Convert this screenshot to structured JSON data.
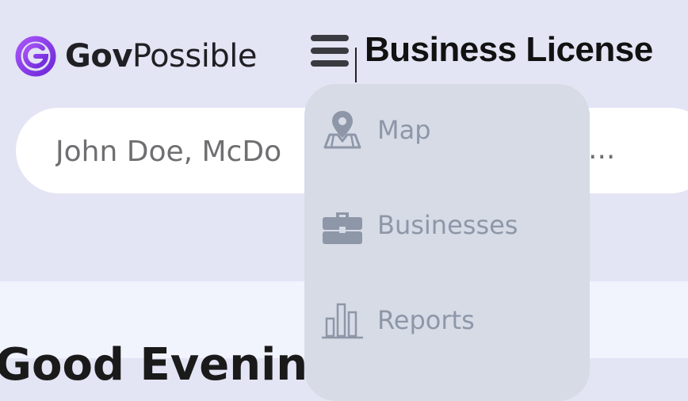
{
  "brand": {
    "name_bold": "Gov",
    "name_regular": "Possible"
  },
  "header": {
    "title": "Business License"
  },
  "search": {
    "placeholder": "John Doe, McDo",
    "placeholder_tail": "..."
  },
  "menu": {
    "items": [
      {
        "label": "Map",
        "icon": "map-pin-icon"
      },
      {
        "label": "Businesses",
        "icon": "briefcase-icon"
      },
      {
        "label": "Reports",
        "icon": "bar-chart-icon"
      }
    ]
  },
  "main": {
    "greeting": "Good Evening!"
  },
  "colors": {
    "accent": "#7c3aed",
    "menu_bg": "#d6dbe6",
    "menu_text": "#8e97a8",
    "header_bg": "#e3e4f4"
  }
}
